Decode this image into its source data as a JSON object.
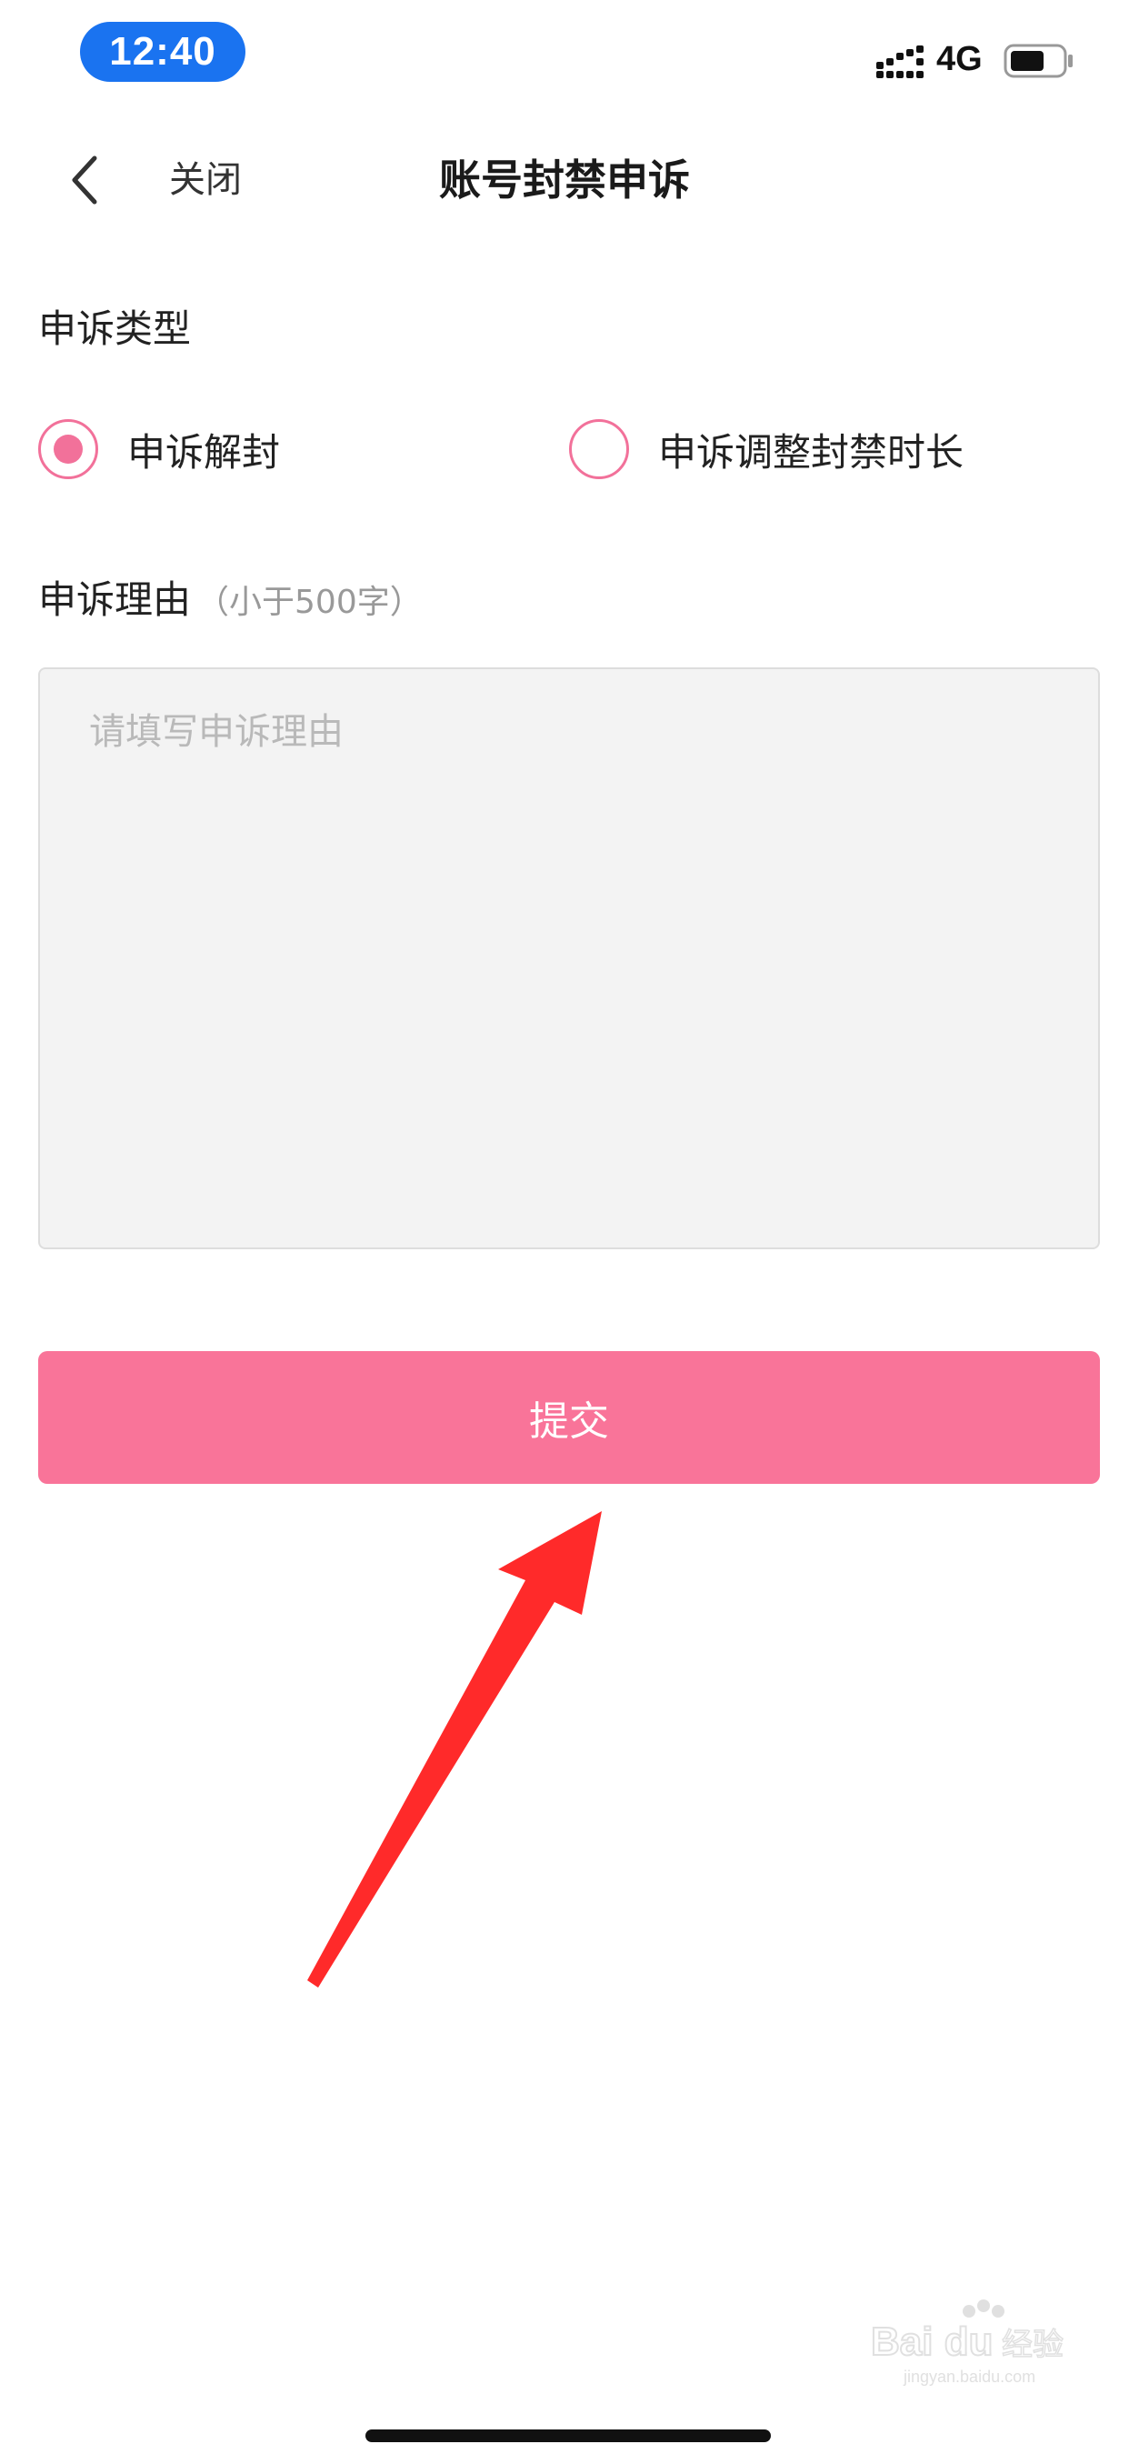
{
  "status_bar": {
    "time": "12:40",
    "network": "4G",
    "icons": [
      "signal-icon",
      "battery-icon"
    ]
  },
  "nav": {
    "back_icon": "chevron-left-icon",
    "close_label": "关闭",
    "title": "账号封禁申诉"
  },
  "form": {
    "type_label": "申诉类型",
    "options": [
      {
        "label": "申诉解封",
        "selected": true
      },
      {
        "label": "申诉调整封禁时长",
        "selected": false
      }
    ],
    "reason_label": "申诉理由",
    "reason_hint": "（小于500字）",
    "reason_value": "",
    "reason_placeholder": "请填写申诉理由",
    "submit_label": "提交"
  },
  "colors": {
    "accent": "#f97499",
    "radio": "#f2719a",
    "time_pill": "#1a73f0",
    "textarea_bg": "#f3f3f3",
    "arrow": "#ff2a2a"
  },
  "watermark": {
    "text": "Bai经验",
    "sub": "jingyan.baidu.com"
  }
}
